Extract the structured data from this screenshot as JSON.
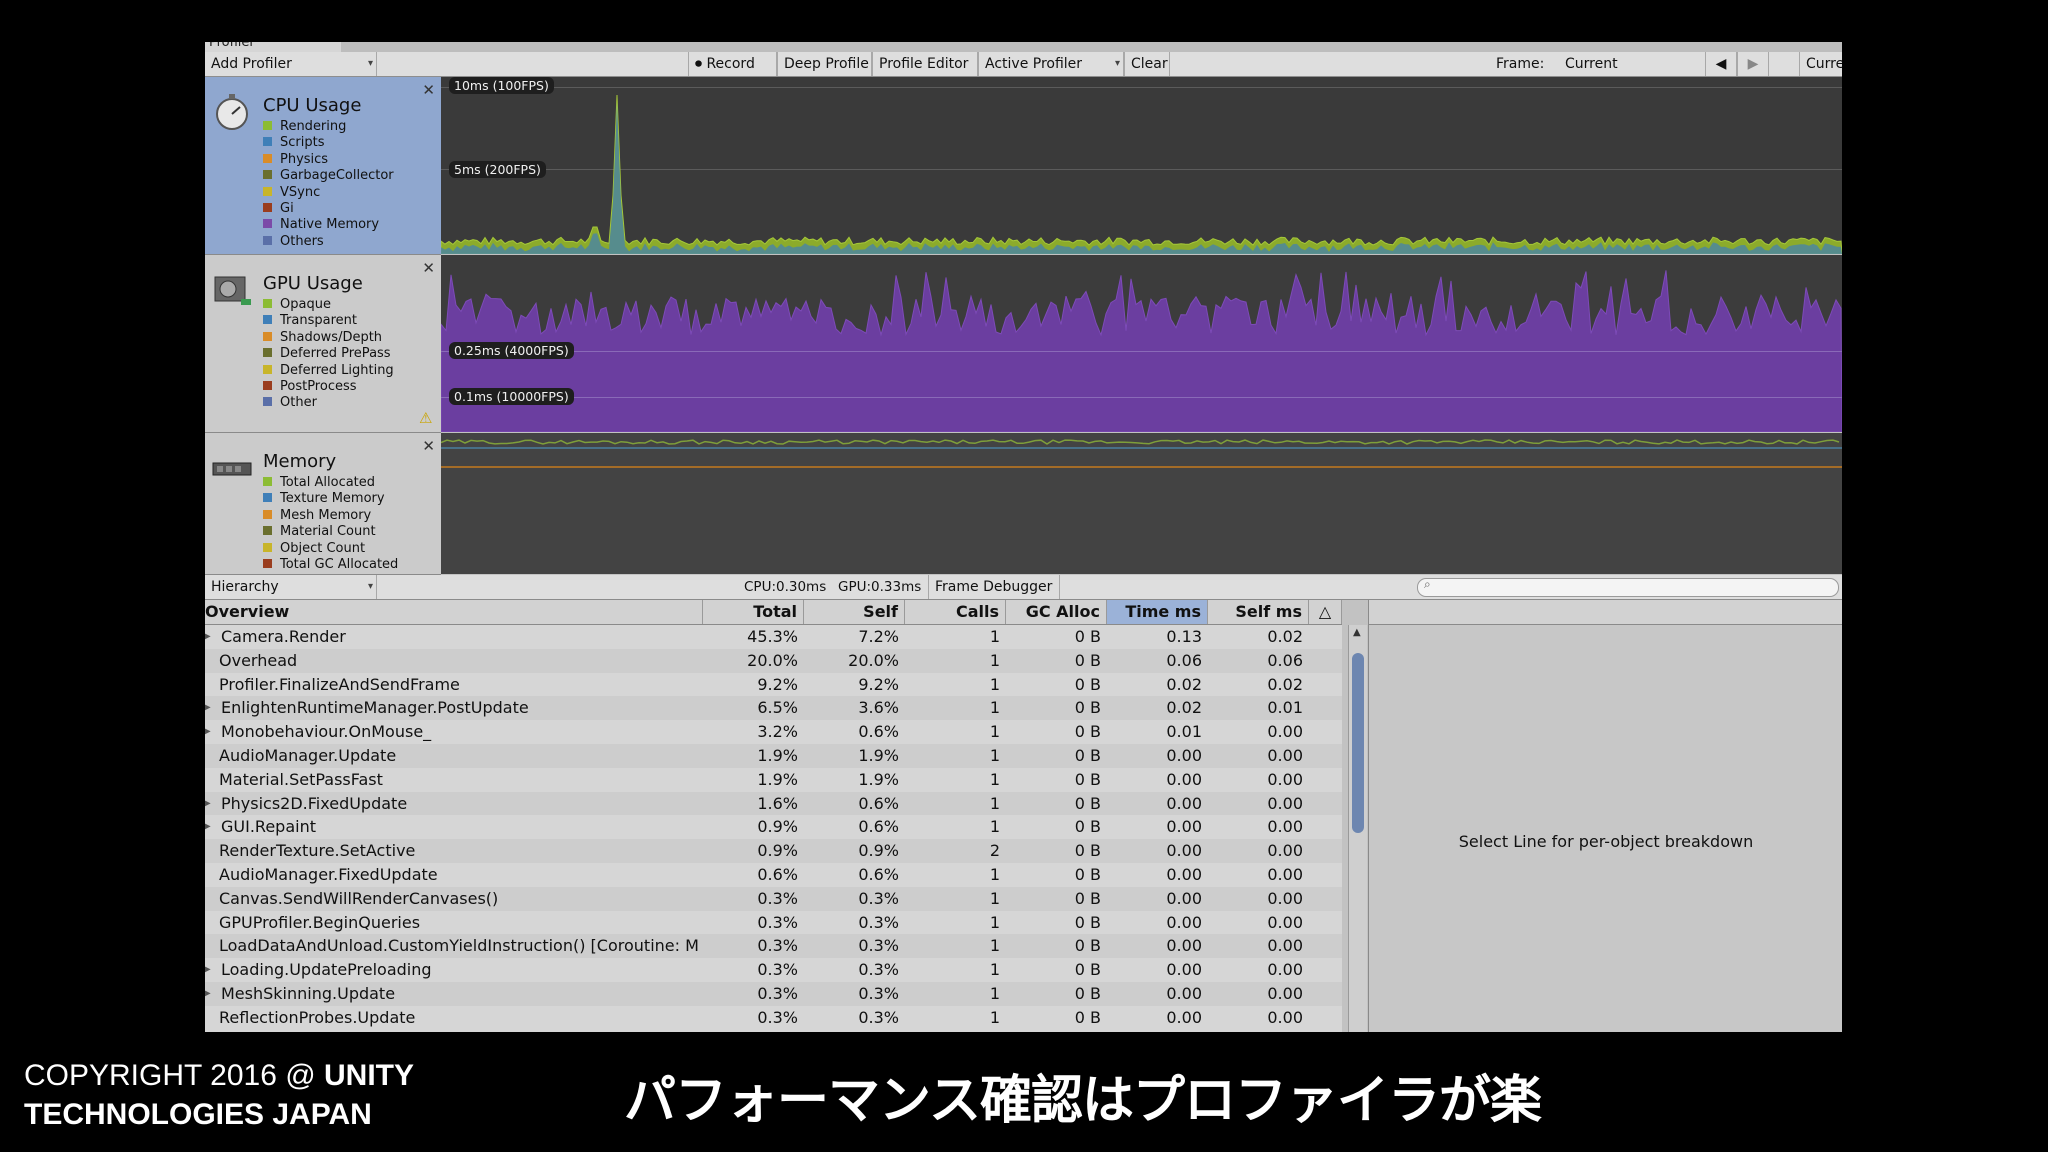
{
  "window": {
    "tab_title": "Profiler"
  },
  "toolbar": {
    "add_profiler": "Add Profiler",
    "record": "Record",
    "deep_profile": "Deep Profile",
    "profile_editor": "Profile Editor",
    "active_profiler": "Active Profiler",
    "clear": "Clear",
    "frame_label": "Frame:",
    "frame_value": "Current",
    "current_btn": "Curre"
  },
  "cpu_panel": {
    "title": "CPU Usage",
    "items": [
      {
        "label": "Rendering",
        "color": "#8cbc34"
      },
      {
        "label": "Scripts",
        "color": "#3f7fb8"
      },
      {
        "label": "Physics",
        "color": "#d98c28"
      },
      {
        "label": "GarbageCollector",
        "color": "#6a6f2e"
      },
      {
        "label": "VSync",
        "color": "#c8b52a"
      },
      {
        "label": "Gi",
        "color": "#9a3d1e"
      },
      {
        "label": "Native Memory",
        "color": "#7b4aa8"
      },
      {
        "label": "Others",
        "color": "#5a6fa8"
      }
    ],
    "label_10ms": "10ms (100FPS)",
    "label_5ms": "5ms (200FPS)"
  },
  "gpu_panel": {
    "title": "GPU Usage",
    "items": [
      {
        "label": "Opaque",
        "color": "#8cbc34"
      },
      {
        "label": "Transparent",
        "color": "#3f7fb8"
      },
      {
        "label": "Shadows/Depth",
        "color": "#d98c28"
      },
      {
        "label": "Deferred PrePass",
        "color": "#6a6f2e"
      },
      {
        "label": "Deferred Lighting",
        "color": "#c8b52a"
      },
      {
        "label": "PostProcess",
        "color": "#9a3d1e"
      },
      {
        "label": "Other",
        "color": "#5a6fa8"
      }
    ],
    "label_025": "0.25ms (4000FPS)",
    "label_01": "0.1ms (10000FPS)"
  },
  "memory_panel": {
    "title": "Memory",
    "items": [
      {
        "label": "Total Allocated",
        "color": "#8cbc34"
      },
      {
        "label": "Texture Memory",
        "color": "#3f7fb8"
      },
      {
        "label": "Mesh Memory",
        "color": "#d98c28"
      },
      {
        "label": "Material Count",
        "color": "#6a6f2e"
      },
      {
        "label": "Object Count",
        "color": "#c8b52a"
      },
      {
        "label": "Total GC Allocated",
        "color": "#9a3d1e"
      }
    ]
  },
  "hierarchy_bar": {
    "view": "Hierarchy",
    "cpu": "CPU:0.30ms",
    "gpu": "GPU:0.33ms",
    "frame_debugger": "Frame Debugger"
  },
  "table": {
    "columns": [
      "Overview",
      "Total",
      "Self",
      "Calls",
      "GC Alloc",
      "Time ms",
      "Self ms"
    ],
    "rows": [
      {
        "name": "Camera.Render",
        "expand": true,
        "total": "45.3%",
        "self": "7.2%",
        "calls": "1",
        "gc": "0 B",
        "time": "0.13",
        "selfms": "0.02"
      },
      {
        "name": "Overhead",
        "expand": false,
        "total": "20.0%",
        "self": "20.0%",
        "calls": "1",
        "gc": "0 B",
        "time": "0.06",
        "selfms": "0.06"
      },
      {
        "name": "Profiler.FinalizeAndSendFrame",
        "expand": false,
        "total": "9.2%",
        "self": "9.2%",
        "calls": "1",
        "gc": "0 B",
        "time": "0.02",
        "selfms": "0.02"
      },
      {
        "name": "EnlightenRuntimeManager.PostUpdate",
        "expand": true,
        "total": "6.5%",
        "self": "3.6%",
        "calls": "1",
        "gc": "0 B",
        "time": "0.02",
        "selfms": "0.01"
      },
      {
        "name": "Monobehaviour.OnMouse_",
        "expand": true,
        "total": "3.2%",
        "self": "0.6%",
        "calls": "1",
        "gc": "0 B",
        "time": "0.01",
        "selfms": "0.00"
      },
      {
        "name": "AudioManager.Update",
        "expand": false,
        "total": "1.9%",
        "self": "1.9%",
        "calls": "1",
        "gc": "0 B",
        "time": "0.00",
        "selfms": "0.00"
      },
      {
        "name": "Material.SetPassFast",
        "expand": false,
        "total": "1.9%",
        "self": "1.9%",
        "calls": "1",
        "gc": "0 B",
        "time": "0.00",
        "selfms": "0.00"
      },
      {
        "name": "Physics2D.FixedUpdate",
        "expand": true,
        "total": "1.6%",
        "self": "0.6%",
        "calls": "1",
        "gc": "0 B",
        "time": "0.00",
        "selfms": "0.00"
      },
      {
        "name": "GUI.Repaint",
        "expand": true,
        "total": "0.9%",
        "self": "0.6%",
        "calls": "1",
        "gc": "0 B",
        "time": "0.00",
        "selfms": "0.00"
      },
      {
        "name": "RenderTexture.SetActive",
        "expand": false,
        "total": "0.9%",
        "self": "0.9%",
        "calls": "2",
        "gc": "0 B",
        "time": "0.00",
        "selfms": "0.00"
      },
      {
        "name": "AudioManager.FixedUpdate",
        "expand": false,
        "total": "0.6%",
        "self": "0.6%",
        "calls": "1",
        "gc": "0 B",
        "time": "0.00",
        "selfms": "0.00"
      },
      {
        "name": "Canvas.SendWillRenderCanvases()",
        "expand": false,
        "total": "0.3%",
        "self": "0.3%",
        "calls": "1",
        "gc": "0 B",
        "time": "0.00",
        "selfms": "0.00"
      },
      {
        "name": "GPUProfiler.BeginQueries",
        "expand": false,
        "total": "0.3%",
        "self": "0.3%",
        "calls": "1",
        "gc": "0 B",
        "time": "0.00",
        "selfms": "0.00"
      },
      {
        "name": "LoadDataAndUnload.CustomYieldInstruction() [Coroutine: M",
        "expand": false,
        "total": "0.3%",
        "self": "0.3%",
        "calls": "1",
        "gc": "0 B",
        "time": "0.00",
        "selfms": "0.00"
      },
      {
        "name": "Loading.UpdatePreloading",
        "expand": true,
        "total": "0.3%",
        "self": "0.3%",
        "calls": "1",
        "gc": "0 B",
        "time": "0.00",
        "selfms": "0.00"
      },
      {
        "name": "MeshSkinning.Update",
        "expand": true,
        "total": "0.3%",
        "self": "0.3%",
        "calls": "1",
        "gc": "0 B",
        "time": "0.00",
        "selfms": "0.00"
      },
      {
        "name": "ReflectionProbes.Update",
        "expand": false,
        "total": "0.3%",
        "self": "0.3%",
        "calls": "1",
        "gc": "0 B",
        "time": "0.00",
        "selfms": "0.00"
      }
    ]
  },
  "detail": {
    "message": "Select Line for per-object breakdown"
  },
  "slide": {
    "copyright_line1_prefix": "COPYRIGHT 2016 @ ",
    "copyright_line1_bold": "UNITY",
    "copyright_line2": "TECHNOLOGIES JAPAN",
    "caption": "パフォーマンス確認はプロファイラが楽"
  }
}
